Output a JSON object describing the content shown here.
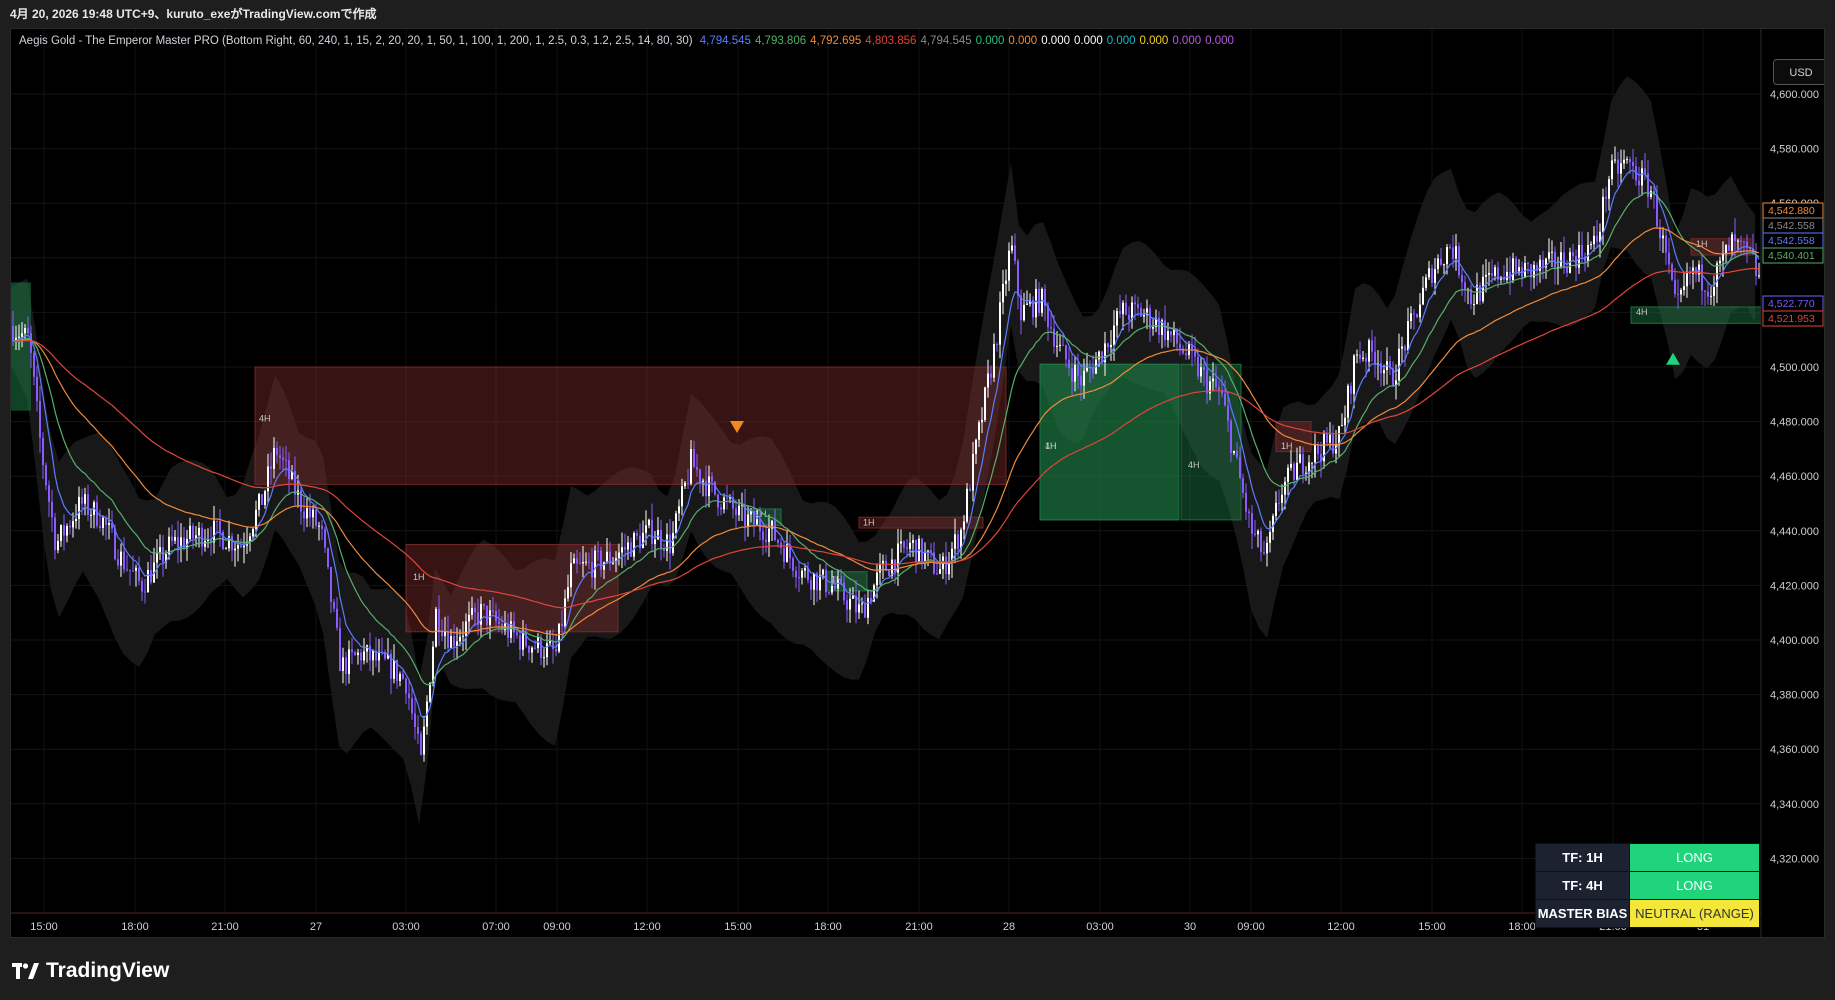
{
  "header": {
    "caption": "4月 20, 2026 19:48 UTC+9、kuruto_exeがTradingView.comで作成"
  },
  "indicator": {
    "title": "Aegis Gold - The Emperor Master PRO (Bottom Right, 60, 240, 1, 15, 2, 20, 20, 1, 50, 1, 100, 1, 200, 1, 2.5, 0.3, 1.2, 2.5, 14, 80, 30)",
    "values": [
      {
        "text": "4,794.545",
        "color": "#5b7cff"
      },
      {
        "text": "4,793.806",
        "color": "#55b06a"
      },
      {
        "text": "4,792.695",
        "color": "#f08a3a"
      },
      {
        "text": "4,803.856",
        "color": "#e0453a"
      },
      {
        "text": "4,794.545",
        "color": "#8a8a8a"
      },
      {
        "text": "0.000",
        "color": "#26c281"
      },
      {
        "text": "0.000",
        "color": "#f08a3a"
      },
      {
        "text": "0.000",
        "color": "#ffffff"
      },
      {
        "text": "0.000",
        "color": "#ffffff"
      },
      {
        "text": "0.000",
        "color": "#1fb6c9"
      },
      {
        "text": "0.000",
        "color": "#f5d31a"
      },
      {
        "text": "0.000",
        "color": "#b45ae0"
      },
      {
        "text": "0.000",
        "color": "#b45ae0"
      }
    ]
  },
  "currency_button": "USD",
  "price_axis": {
    "ticks": [
      "4,600.000",
      "4,580.000",
      "4,560.000",
      "4,540.000",
      "4,520.000",
      "4,500.000",
      "4,480.000",
      "4,460.000",
      "4,440.000",
      "4,420.000",
      "4,400.000",
      "4,380.000",
      "4,360.000",
      "4,340.000",
      "4,320.000"
    ],
    "tags": [
      {
        "text": "4,542.880",
        "color": "#f08a3a",
        "price": 4542.88
      },
      {
        "text": "4,542.558",
        "color": "#8a8a8a",
        "price": 4542.558
      },
      {
        "text": "4,542.558",
        "color": "#5b7cff",
        "price": 4542.558
      },
      {
        "text": "4,540.401",
        "color": "#55b06a",
        "price": 4540.401
      },
      {
        "text": "4,522.770",
        "color": "#7a5cff",
        "price": 4522.77
      },
      {
        "text": "4,521.953",
        "color": "#e0453a",
        "price": 4521.953
      }
    ]
  },
  "time_axis": {
    "labels": [
      "15:00",
      "18:00",
      "21:00",
      "27",
      "03:00",
      "07:00",
      "09:00",
      "12:00",
      "15:00",
      "18:00",
      "21:00",
      "28",
      "03:00",
      "30",
      "09:00",
      "12:00",
      "15:00",
      "18:00",
      "21:00",
      "31"
    ]
  },
  "zones": [
    {
      "label": "4H",
      "kind": "supply"
    },
    {
      "label": "1H",
      "kind": "supply"
    },
    {
      "label": "1H",
      "kind": "supply"
    },
    {
      "label": "4H",
      "kind": "demand"
    },
    {
      "label": "1H",
      "kind": "demand"
    },
    {
      "label": "1H",
      "kind": "demand"
    },
    {
      "label": "4H",
      "kind": "demand"
    },
    {
      "label": "1H",
      "kind": "supply"
    },
    {
      "label": "1H",
      "kind": "demand"
    },
    {
      "label": "4H",
      "kind": "demand"
    },
    {
      "label": "1H",
      "kind": "supply"
    }
  ],
  "bias_table": {
    "rows": [
      {
        "key": "TF: 1H",
        "value": "LONG",
        "bg": "#1fd47a",
        "fg": "#ffffff"
      },
      {
        "key": "TF: 4H",
        "value": "LONG",
        "bg": "#1fd47a",
        "fg": "#ffffff"
      },
      {
        "key": "MASTER BIAS",
        "value": "NEUTRAL (RANGE)",
        "bg": "#f5e63a",
        "fg": "#333333"
      }
    ]
  },
  "branding": {
    "logo_text": "TradingView"
  },
  "colors": {
    "background": "#000000",
    "candle_up": "#ffffff",
    "candle_down": "#8a5cff",
    "supply_zone": "#7a2a2a",
    "demand_zone": "#1d7a45",
    "ma_blue": "#5b7cff",
    "ma_green": "#55b06a",
    "ma_orange": "#f08a3a",
    "ma_red": "#e0453a",
    "sell_marker": "#f08a1a",
    "buy_marker": "#1fd47a"
  },
  "icons": {
    "sell_marker": "triangle-down-icon",
    "buy_marker": "triangle-up-icon",
    "logo": "tradingview-logo-icon"
  }
}
